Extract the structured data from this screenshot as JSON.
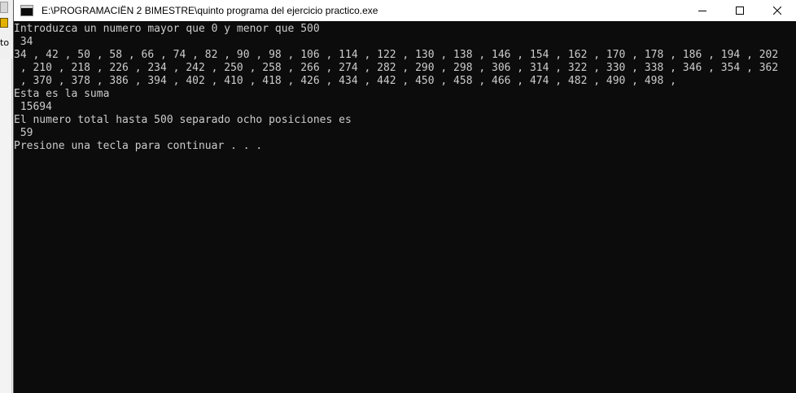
{
  "window": {
    "title": "E:\\PROGRAMACIËN 2 BIMESTRE\\quinto programa del ejercicio practico.exe",
    "background": "#0c0c0c",
    "text_color": "#cccccc"
  },
  "background_app": {
    "partial_label": "to"
  },
  "title_bar_icons": {
    "app": "console-app-icon",
    "minimize": "minimize-icon",
    "maximize": "maximize-icon",
    "close": "close-icon"
  },
  "console": {
    "lines": [
      "Introduzca un numero mayor que 0 y menor que 500",
      " 34",
      "34 , 42 , 50 , 58 , 66 , 74 , 82 , 90 , 98 , 106 , 114 , 122 , 130 , 138 , 146 , 154 , 162 , 170 , 178 , 186 , 194 , 202",
      " , 210 , 218 , 226 , 234 , 242 , 250 , 258 , 266 , 274 , 282 , 290 , 298 , 306 , 314 , 322 , 330 , 338 , 346 , 354 , 362",
      " , 370 , 378 , 386 , 394 , 402 , 410 , 418 , 426 , 434 , 442 , 450 , 458 , 466 , 474 , 482 , 490 , 498 ,",
      "Esta es la suma",
      " 15694",
      "El numero total hasta 500 separado ocho posiciones es",
      " 59",
      "Presione una tecla para continuar . . ."
    ]
  }
}
